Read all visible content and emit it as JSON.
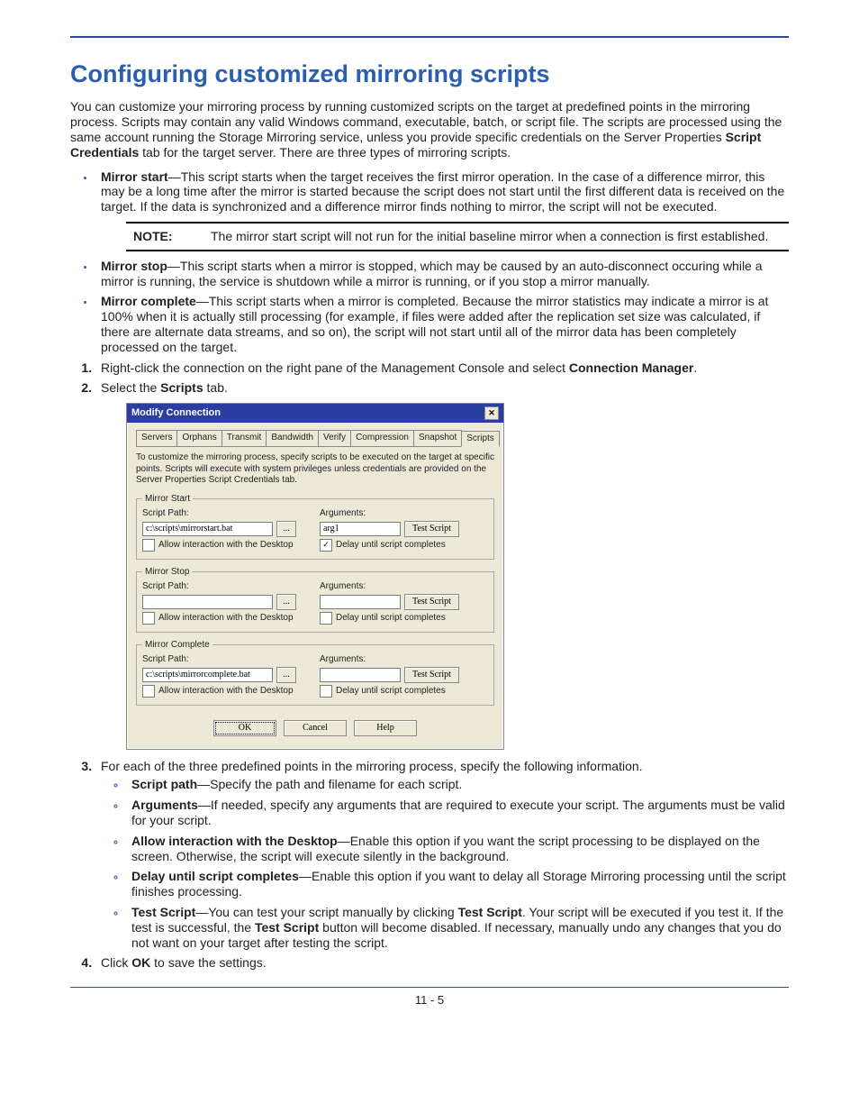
{
  "page": {
    "title": "Configuring customized mirroring scripts",
    "intro_a": "You can customize your mirroring process by running customized scripts on the target at predefined points in the mirroring process. Scripts may contain any valid Windows command, executable, batch, or script file. The scripts are processed using the same account running the Storage Mirroring service, unless you provide specific credentials on the Server Properties ",
    "intro_bold": "Script Credentials",
    "intro_b": " tab for the target server. There are three types of mirroring scripts.",
    "page_num": "11 - 5"
  },
  "bullets1": {
    "ms_label": "Mirror start",
    "ms_text": "—This script starts when the target receives the first mirror operation. In the case of a difference mirror, this may be a long time after the mirror is started because the script does not start until the first different data is received on the target. If the data is synchronized and a difference mirror finds nothing to mirror, the script will not be executed.",
    "note_label": "NOTE:",
    "note_text": "The mirror start script will not run for the initial baseline mirror when a connection is first established.",
    "mstop_label": "Mirror stop",
    "mstop_text": "—This script starts when a mirror is stopped, which may be caused by an auto-disconnect occuring while a mirror is running, the service is shutdown while a mirror is running, or if you stop a mirror manually.",
    "mc_label": "Mirror complete",
    "mc_text": "—This script starts when a mirror is completed. Because the mirror statistics may indicate a mirror is at 100% when it is actually still processing (for example, if files were added after the replication set size was calculated, if there are alternate data streams, and so on), the script will not start until all of the mirror data has been completely processed on the target."
  },
  "steps": {
    "s1a": "Right-click the connection on the right pane of the Management Console and select ",
    "s1b": "Connection Manager",
    "s1c": ".",
    "s2a": "Select the ",
    "s2b": "Scripts",
    "s2c": " tab.",
    "s3": "For each of the three predefined points in the mirroring process, specify the following information.",
    "s4a": "Click ",
    "s4b": "OK",
    "s4c": " to save the settings."
  },
  "sub": {
    "sp_l": "Script path",
    "sp_t": "—Specify the path and filename for each script.",
    "arg_l": "Arguments",
    "arg_t": "—If needed, specify any arguments that are required to execute your script. The arguments must be valid for your script.",
    "aid_l": "Allow interaction with the Desktop",
    "aid_t": "—Enable this option if you want the script processing to be displayed on the screen. Otherwise, the script will execute silently in the background.",
    "del_l": "Delay until script completes",
    "del_t": "—Enable this option if you want to delay all Storage Mirroring processing until the script finishes processing.",
    "ts_l": "Test Script",
    "ts_a": "—You can test your script manually by clicking ",
    "ts_b": "Test Script",
    "ts_c": ". Your script will be executed if you test it. If the test is successful, the ",
    "ts_d": "Test Script",
    "ts_e": " button will become disabled. If necessary, manually undo any changes that you do not want on your target after testing the script."
  },
  "dialog": {
    "title": "Modify Connection",
    "tabs": [
      "Servers",
      "Orphans",
      "Transmit",
      "Bandwidth",
      "Verify",
      "Compression",
      "Snapshot",
      "Scripts"
    ],
    "desc": "To customize the mirroring process, specify scripts to be executed on the target at specific points. Scripts will execute with system privileges unless credentials are provided on the Server Properties Script Credentials tab.",
    "grp1": "Mirror Start",
    "grp2": "Mirror Stop",
    "grp3": "Mirror Complete",
    "script_path_label": "Script Path:",
    "arguments_label": "Arguments:",
    "path1": "c:\\scripts\\mirrorstart.bat",
    "arg1": "arg1",
    "path2": "",
    "arg2": "",
    "path3": "c:\\scripts\\mirrorcomplete.bat",
    "arg3": "",
    "browse": "...",
    "test": "Test Script",
    "allow": "Allow interaction with the Desktop",
    "delay": "Delay until script completes",
    "ok": "OK",
    "cancel": "Cancel",
    "help": "Help"
  }
}
